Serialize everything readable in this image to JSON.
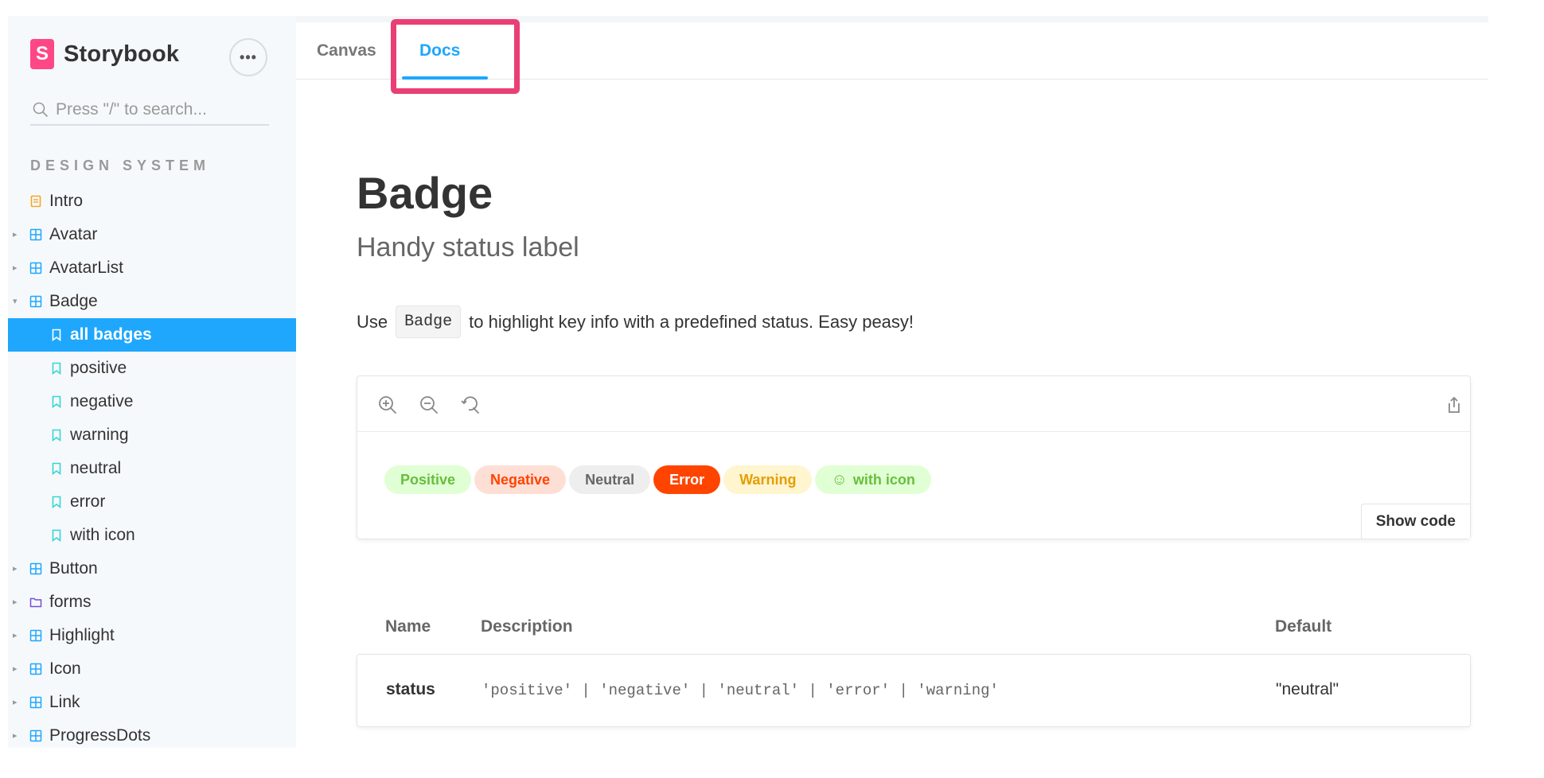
{
  "sidebar": {
    "brand": {
      "logo_letter": "S",
      "name": "Storybook"
    },
    "more_label": "•••",
    "search_placeholder": "Press \"/\" to search...",
    "section_title": "DESIGN SYSTEM",
    "items": [
      {
        "label": "Intro",
        "type": "doc"
      },
      {
        "label": "Avatar",
        "type": "component"
      },
      {
        "label": "AvatarList",
        "type": "component"
      },
      {
        "label": "Badge",
        "type": "component",
        "expanded": true
      },
      {
        "label": "all badges",
        "type": "story",
        "active": true
      },
      {
        "label": "positive",
        "type": "story"
      },
      {
        "label": "negative",
        "type": "story"
      },
      {
        "label": "warning",
        "type": "story"
      },
      {
        "label": "neutral",
        "type": "story"
      },
      {
        "label": "error",
        "type": "story"
      },
      {
        "label": "with icon",
        "type": "story"
      },
      {
        "label": "Button",
        "type": "component"
      },
      {
        "label": "forms",
        "type": "folder"
      },
      {
        "label": "Highlight",
        "type": "component"
      },
      {
        "label": "Icon",
        "type": "component"
      },
      {
        "label": "Link",
        "type": "component"
      },
      {
        "label": "ProgressDots",
        "type": "component"
      }
    ]
  },
  "tabs": {
    "canvas": "Canvas",
    "docs": "Docs"
  },
  "doc": {
    "title": "Badge",
    "subtitle": "Handy status label",
    "desc_before": "Use",
    "desc_code": "Badge",
    "desc_after": "to highlight key info with a predefined status. Easy peasy!"
  },
  "preview": {
    "badges": {
      "positive": "Positive",
      "negative": "Negative",
      "neutral": "Neutral",
      "error": "Error",
      "warning": "Warning",
      "with_icon": "with icon",
      "with_icon_glyph": "☺"
    },
    "show_code": "Show code"
  },
  "props": {
    "headers": {
      "name": "Name",
      "description": "Description",
      "default": "Default"
    },
    "row": {
      "name": "status",
      "description": "'positive' | 'negative' | 'neutral' | 'error' | 'warning'",
      "default": "\"neutral\""
    }
  },
  "colors": {
    "accent": "#1ea7fd",
    "brand": "#ff4785",
    "highlight": "#ea3f74"
  }
}
